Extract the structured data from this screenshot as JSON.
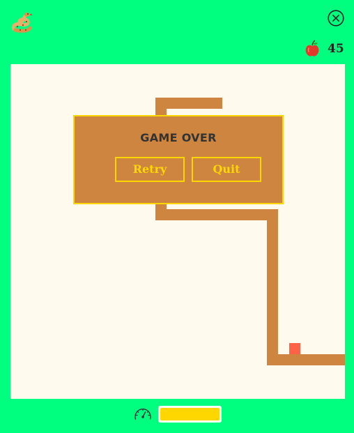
{
  "app": {
    "logo_icon": "snake-icon",
    "close_icon": "close-icon"
  },
  "score": {
    "icon": "apple-icon",
    "value": "45"
  },
  "board": {
    "background": "#fefaee",
    "snake_color": "#cd853f",
    "food_color": "#ff6347"
  },
  "game_over": {
    "title": "GAME OVER",
    "retry_label": "Retry",
    "quit_label": "Quit"
  },
  "speed": {
    "icon": "speedometer-icon",
    "level": 1.0
  },
  "colors": {
    "page_background": "#00ff7f",
    "accent": "#ffd700"
  }
}
